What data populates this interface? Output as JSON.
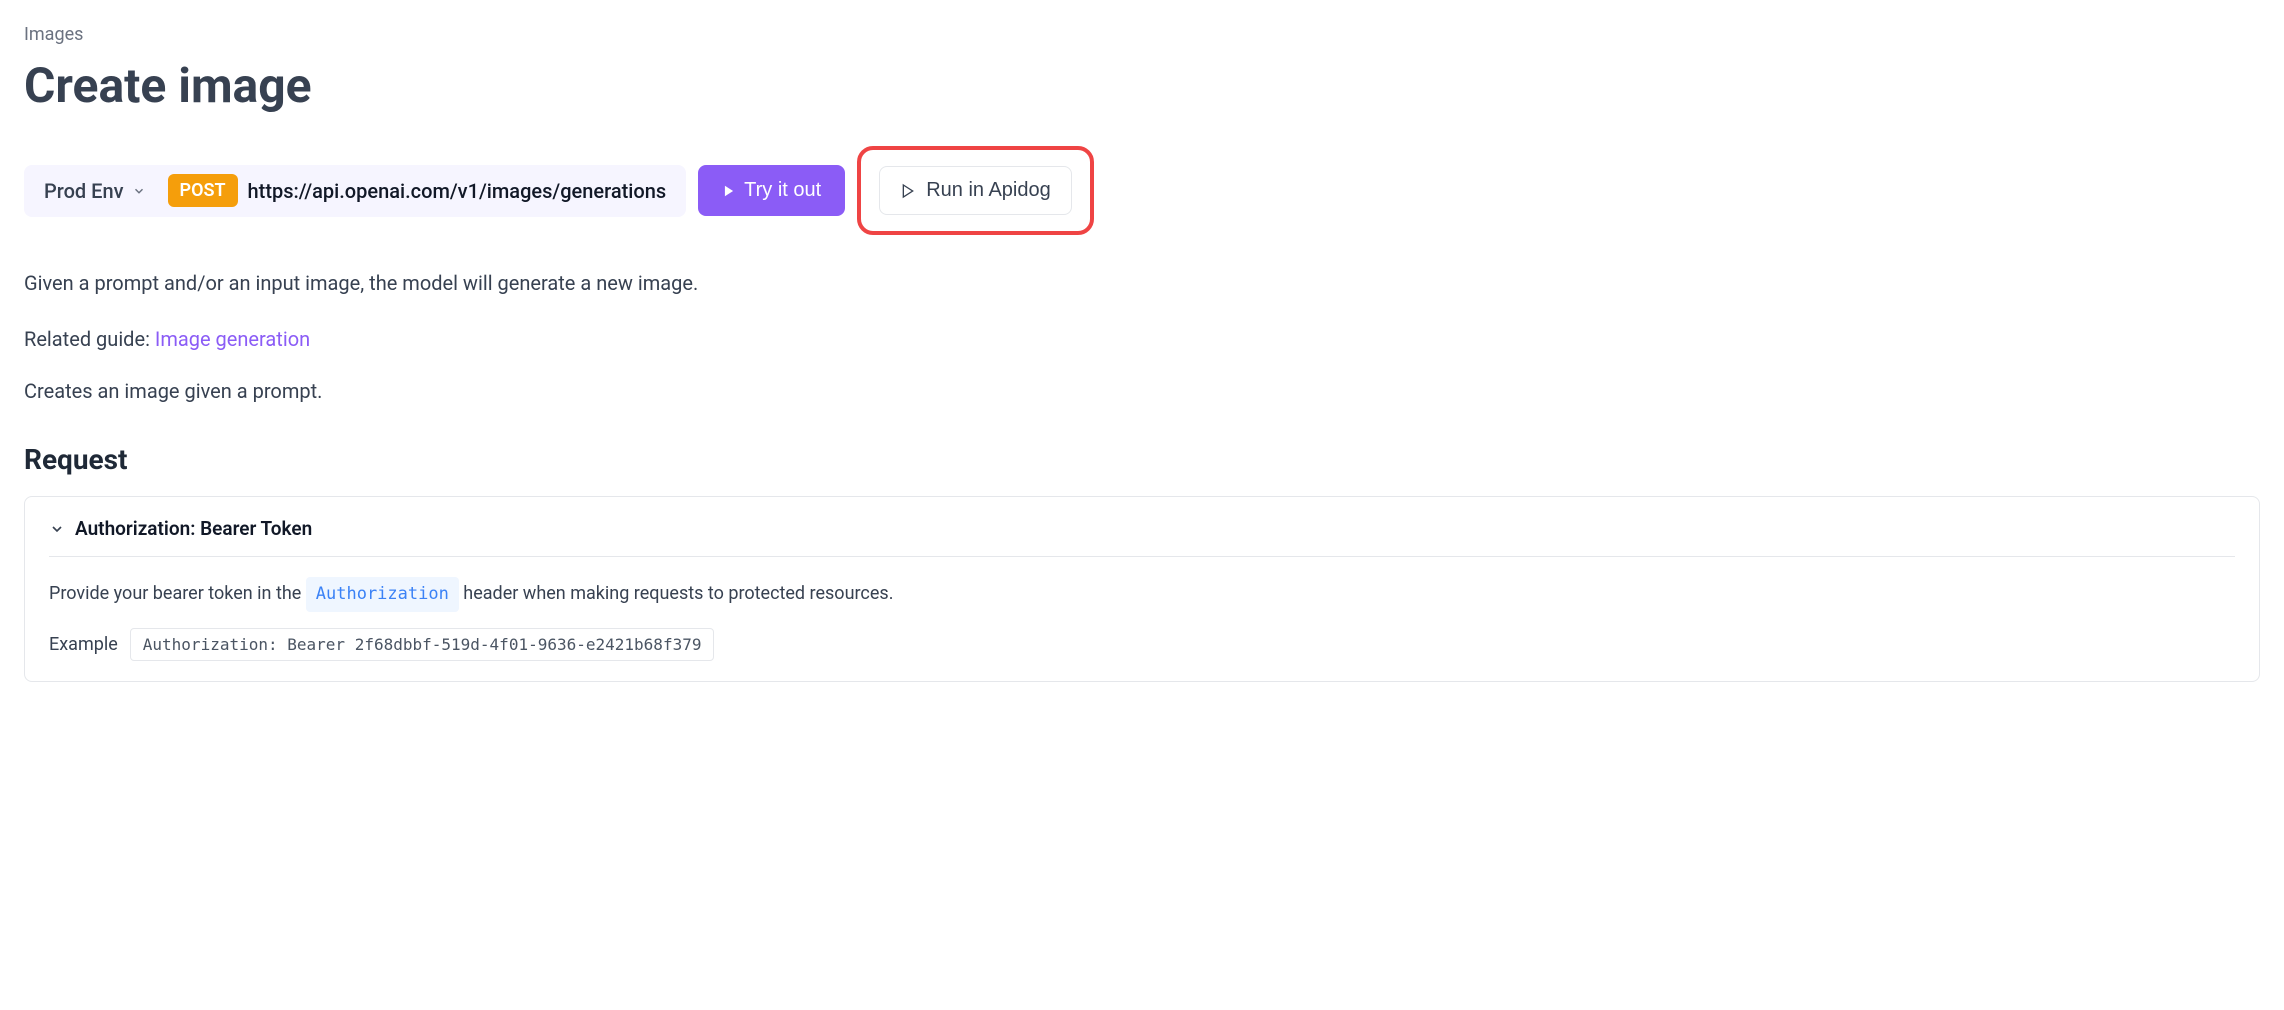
{
  "breadcrumb": "Images",
  "page_title": "Create image",
  "url_bar": {
    "env_label": "Prod Env",
    "method": "POST",
    "url": "https://api.openai.com/v1/images/generations"
  },
  "buttons": {
    "try_it_out": "Try it out",
    "run_in_apidog": "Run in Apidog"
  },
  "description": "Given a prompt and/or an input image, the model will generate a new image.",
  "related_guide": {
    "prefix": "Related guide: ",
    "link_text": "Image generation"
  },
  "creates_text": "Creates an image given a prompt.",
  "section_heading": "Request",
  "auth": {
    "title": "Authorization: Bearer Token",
    "description_prefix": "Provide your bearer token in the ",
    "header_name": "Authorization",
    "description_suffix": " header when making requests to protected resources.",
    "example_label": "Example",
    "example_value": "Authorization: Bearer 2f68dbbf-519d-4f01-9636-e2421b68f379"
  }
}
